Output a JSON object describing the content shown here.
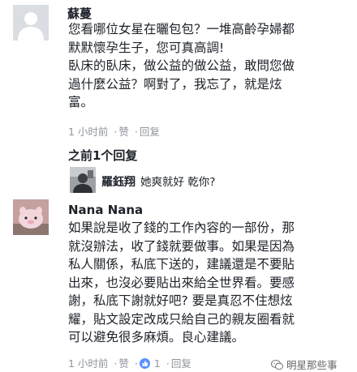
{
  "comment1": {
    "author": "蘇蔓",
    "lines": [
      "您看哪位女星在曬包包？一堆高齡孕婦都",
      "默默懷孕生子，您可真高調!",
      "臥床的臥床，做公益的做公益，敢問您做",
      "過什麼公益？啊對了，我忘了，就是炫",
      "富。"
    ],
    "time": "1 小时前",
    "like": "赞",
    "reply": "回复"
  },
  "previous_replies": "之前1个回复",
  "reply1": {
    "author": "羅鈺翔",
    "text": "她爽就好 乾你?"
  },
  "comment2": {
    "author": "Nana Nana",
    "lines": [
      "如果說是收了錢的工作內容的一部份，那",
      "就沒辦法，收了錢就要做事。如果是因為",
      "私人關係，私底下送的，建議還是不要貼",
      "出來，也沒必要貼出來給全世界看。要感",
      "謝，私底下謝就好吧? 要是真忍不住想炫",
      "耀，貼文設定改成只給自己的親友圈看就",
      "可以避免很多麻煩。良心建議。"
    ],
    "time": "1 小时前",
    "like": "赞",
    "like_count": "1",
    "reply": "回复"
  },
  "watermark": "明星那些事"
}
